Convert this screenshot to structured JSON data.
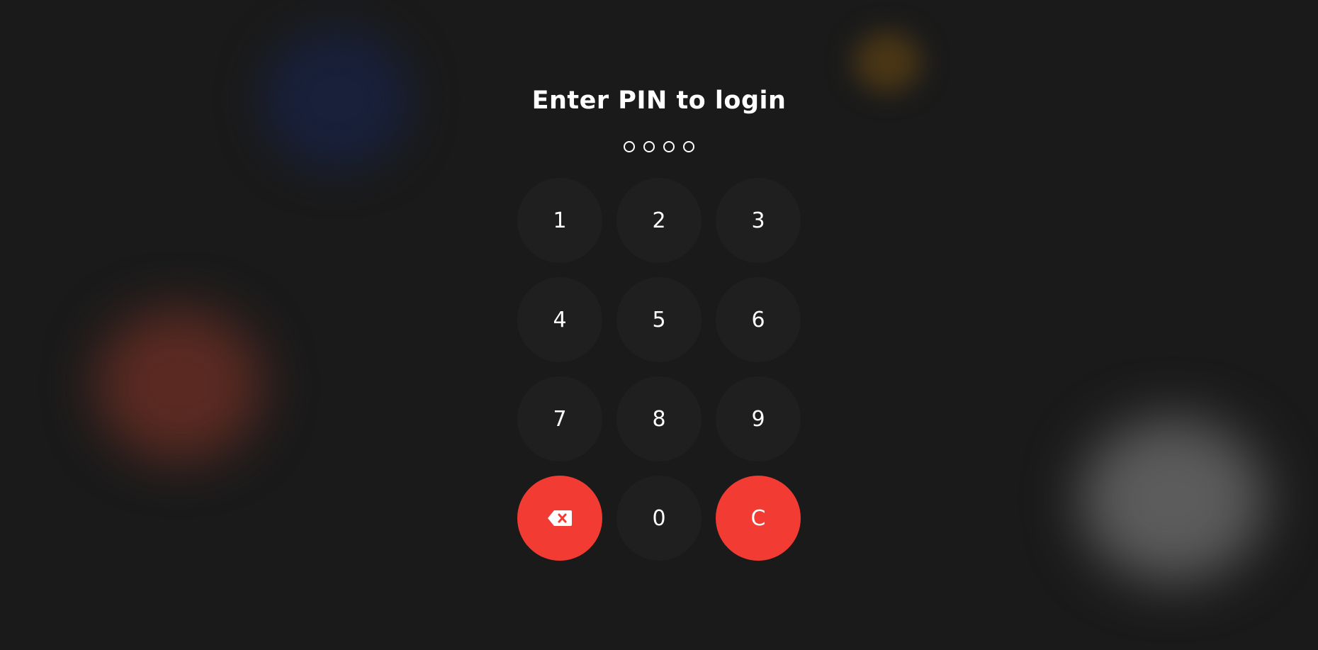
{
  "login": {
    "title": "Enter PIN to login",
    "pin_length": 4,
    "digits_entered": 0
  },
  "keypad": {
    "keys": [
      "1",
      "2",
      "3",
      "4",
      "5",
      "6",
      "7",
      "8",
      "9"
    ],
    "zero": "0",
    "clear": "C",
    "backspace_icon": "backspace-icon"
  },
  "colors": {
    "background": "#1a1a1a",
    "key": "#1f1f1f",
    "accent_red": "#f23b32"
  }
}
